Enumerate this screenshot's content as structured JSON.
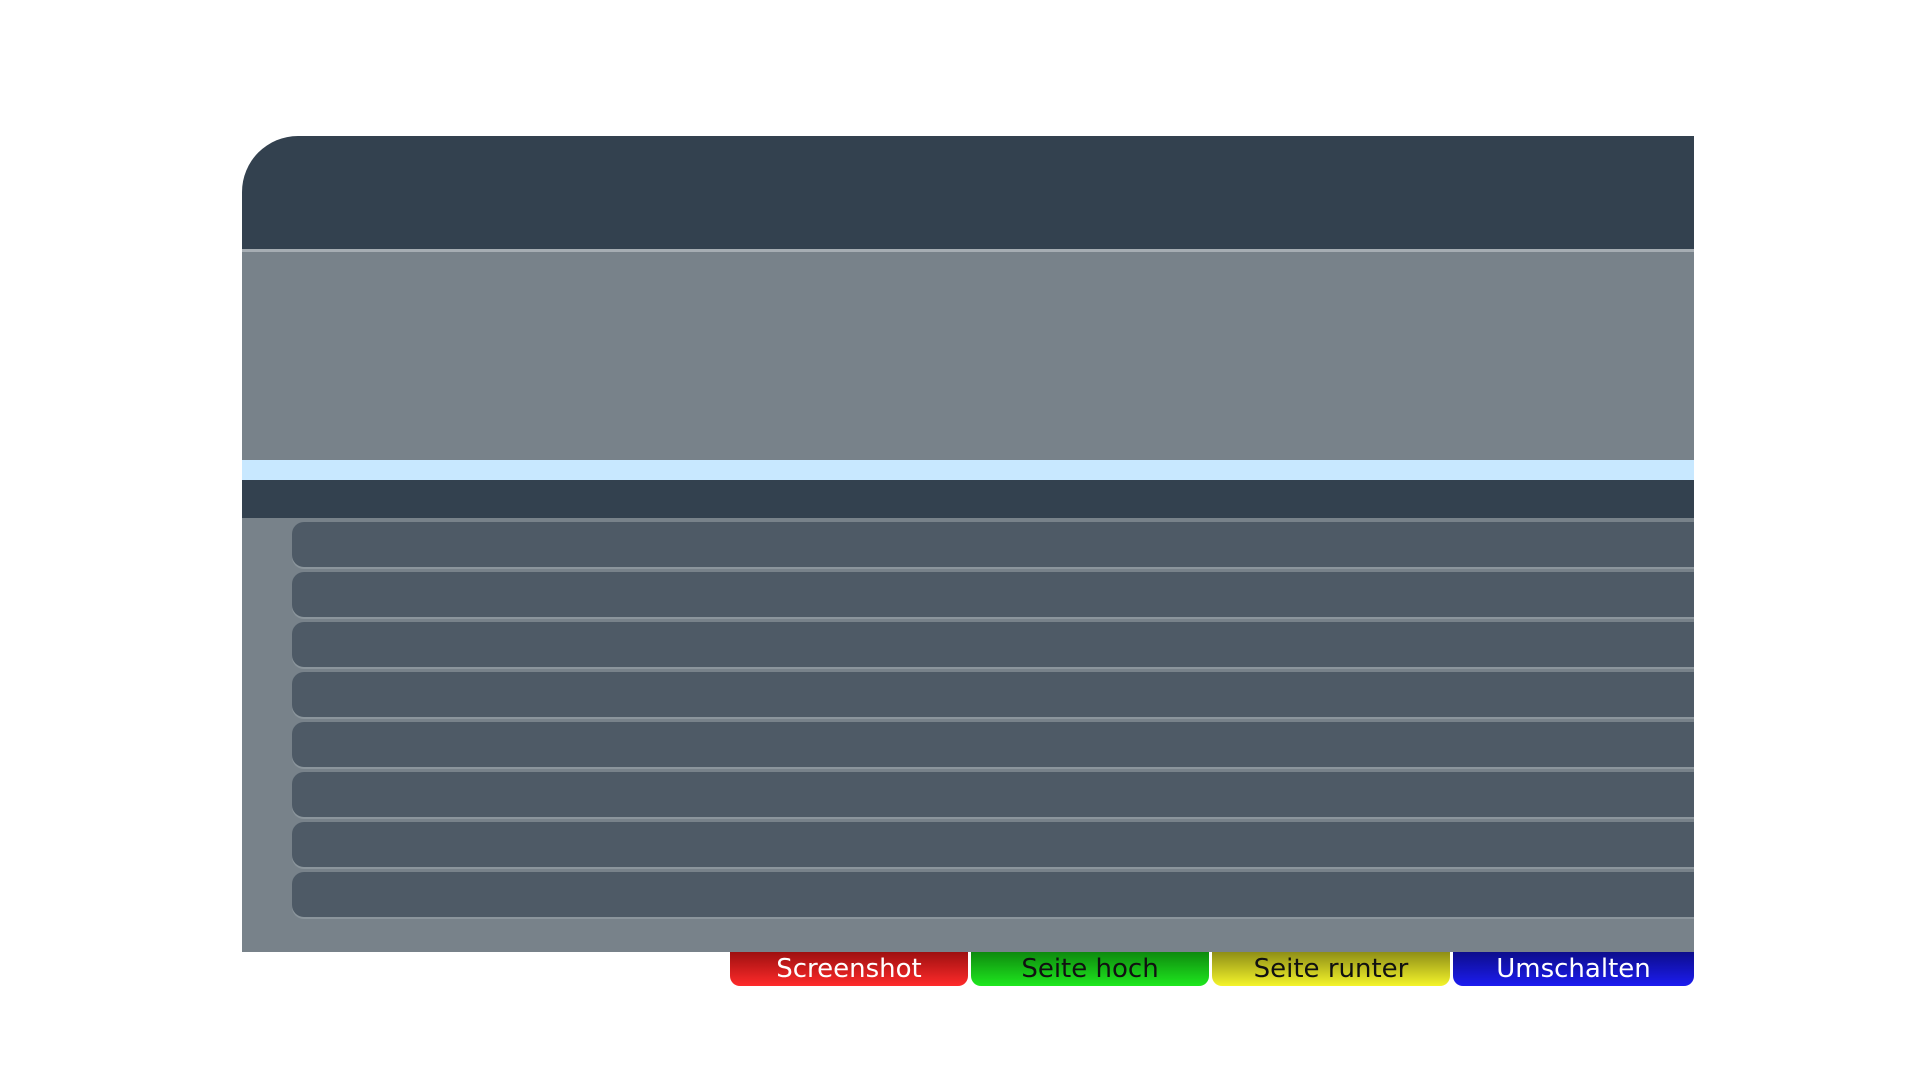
{
  "colors": {
    "header": "#33414f",
    "panel": "#78828a",
    "highlight": "#c8e8ff",
    "row": "#4e5a66",
    "red": "#ff2a2a",
    "green": "#1ee81e",
    "yellow": "#f5f52a",
    "blue": "#1c1cf0"
  },
  "list": {
    "rows": [
      "",
      "",
      "",
      "",
      "",
      "",
      "",
      ""
    ]
  },
  "buttons": {
    "red_label": "Screenshot",
    "green_label": "Seite hoch",
    "yellow_label": "Seite runter",
    "blue_label": "Umschalten"
  }
}
